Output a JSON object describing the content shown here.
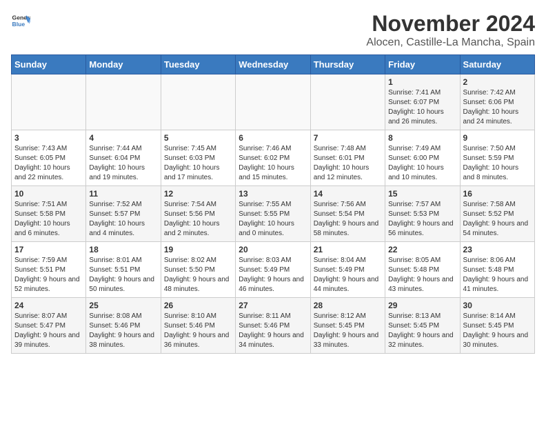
{
  "header": {
    "logo_general": "General",
    "logo_blue": "Blue",
    "month_title": "November 2024",
    "location": "Alocen, Castille-La Mancha, Spain"
  },
  "weekdays": [
    "Sunday",
    "Monday",
    "Tuesday",
    "Wednesday",
    "Thursday",
    "Friday",
    "Saturday"
  ],
  "weeks": [
    [
      {
        "day": "",
        "info": ""
      },
      {
        "day": "",
        "info": ""
      },
      {
        "day": "",
        "info": ""
      },
      {
        "day": "",
        "info": ""
      },
      {
        "day": "",
        "info": ""
      },
      {
        "day": "1",
        "info": "Sunrise: 7:41 AM\nSunset: 6:07 PM\nDaylight: 10 hours and 26 minutes."
      },
      {
        "day": "2",
        "info": "Sunrise: 7:42 AM\nSunset: 6:06 PM\nDaylight: 10 hours and 24 minutes."
      }
    ],
    [
      {
        "day": "3",
        "info": "Sunrise: 7:43 AM\nSunset: 6:05 PM\nDaylight: 10 hours and 22 minutes."
      },
      {
        "day": "4",
        "info": "Sunrise: 7:44 AM\nSunset: 6:04 PM\nDaylight: 10 hours and 19 minutes."
      },
      {
        "day": "5",
        "info": "Sunrise: 7:45 AM\nSunset: 6:03 PM\nDaylight: 10 hours and 17 minutes."
      },
      {
        "day": "6",
        "info": "Sunrise: 7:46 AM\nSunset: 6:02 PM\nDaylight: 10 hours and 15 minutes."
      },
      {
        "day": "7",
        "info": "Sunrise: 7:48 AM\nSunset: 6:01 PM\nDaylight: 10 hours and 12 minutes."
      },
      {
        "day": "8",
        "info": "Sunrise: 7:49 AM\nSunset: 6:00 PM\nDaylight: 10 hours and 10 minutes."
      },
      {
        "day": "9",
        "info": "Sunrise: 7:50 AM\nSunset: 5:59 PM\nDaylight: 10 hours and 8 minutes."
      }
    ],
    [
      {
        "day": "10",
        "info": "Sunrise: 7:51 AM\nSunset: 5:58 PM\nDaylight: 10 hours and 6 minutes."
      },
      {
        "day": "11",
        "info": "Sunrise: 7:52 AM\nSunset: 5:57 PM\nDaylight: 10 hours and 4 minutes."
      },
      {
        "day": "12",
        "info": "Sunrise: 7:54 AM\nSunset: 5:56 PM\nDaylight: 10 hours and 2 minutes."
      },
      {
        "day": "13",
        "info": "Sunrise: 7:55 AM\nSunset: 5:55 PM\nDaylight: 10 hours and 0 minutes."
      },
      {
        "day": "14",
        "info": "Sunrise: 7:56 AM\nSunset: 5:54 PM\nDaylight: 9 hours and 58 minutes."
      },
      {
        "day": "15",
        "info": "Sunrise: 7:57 AM\nSunset: 5:53 PM\nDaylight: 9 hours and 56 minutes."
      },
      {
        "day": "16",
        "info": "Sunrise: 7:58 AM\nSunset: 5:52 PM\nDaylight: 9 hours and 54 minutes."
      }
    ],
    [
      {
        "day": "17",
        "info": "Sunrise: 7:59 AM\nSunset: 5:51 PM\nDaylight: 9 hours and 52 minutes."
      },
      {
        "day": "18",
        "info": "Sunrise: 8:01 AM\nSunset: 5:51 PM\nDaylight: 9 hours and 50 minutes."
      },
      {
        "day": "19",
        "info": "Sunrise: 8:02 AM\nSunset: 5:50 PM\nDaylight: 9 hours and 48 minutes."
      },
      {
        "day": "20",
        "info": "Sunrise: 8:03 AM\nSunset: 5:49 PM\nDaylight: 9 hours and 46 minutes."
      },
      {
        "day": "21",
        "info": "Sunrise: 8:04 AM\nSunset: 5:49 PM\nDaylight: 9 hours and 44 minutes."
      },
      {
        "day": "22",
        "info": "Sunrise: 8:05 AM\nSunset: 5:48 PM\nDaylight: 9 hours and 43 minutes."
      },
      {
        "day": "23",
        "info": "Sunrise: 8:06 AM\nSunset: 5:48 PM\nDaylight: 9 hours and 41 minutes."
      }
    ],
    [
      {
        "day": "24",
        "info": "Sunrise: 8:07 AM\nSunset: 5:47 PM\nDaylight: 9 hours and 39 minutes."
      },
      {
        "day": "25",
        "info": "Sunrise: 8:08 AM\nSunset: 5:46 PM\nDaylight: 9 hours and 38 minutes."
      },
      {
        "day": "26",
        "info": "Sunrise: 8:10 AM\nSunset: 5:46 PM\nDaylight: 9 hours and 36 minutes."
      },
      {
        "day": "27",
        "info": "Sunrise: 8:11 AM\nSunset: 5:46 PM\nDaylight: 9 hours and 34 minutes."
      },
      {
        "day": "28",
        "info": "Sunrise: 8:12 AM\nSunset: 5:45 PM\nDaylight: 9 hours and 33 minutes."
      },
      {
        "day": "29",
        "info": "Sunrise: 8:13 AM\nSunset: 5:45 PM\nDaylight: 9 hours and 32 minutes."
      },
      {
        "day": "30",
        "info": "Sunrise: 8:14 AM\nSunset: 5:45 PM\nDaylight: 9 hours and 30 minutes."
      }
    ]
  ]
}
